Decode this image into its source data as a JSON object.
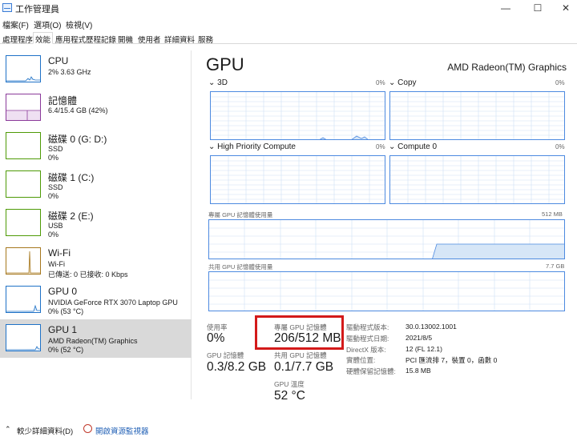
{
  "window": {
    "title": "工作管理員",
    "minimize": "—",
    "maximize": "☐",
    "close": "✕"
  },
  "menu": [
    "檔案(F)",
    "選項(O)",
    "檢視(V)"
  ],
  "tabs": [
    {
      "label": "處理程序"
    },
    {
      "label": "效能",
      "active": true
    },
    {
      "label": "應用程式歷程記錄"
    },
    {
      "label": "開機"
    },
    {
      "label": "使用者"
    },
    {
      "label": "詳細資料"
    },
    {
      "label": "服務"
    }
  ],
  "sidebar": {
    "items": [
      {
        "name": "CPU",
        "line2": "2% 3.63 GHz",
        "line3": "",
        "color": "#1f72c7"
      },
      {
        "name": "記憶體",
        "line2": "6.4/15.4 GB (42%)",
        "line3": "",
        "color": "#8b3a9a"
      },
      {
        "name": "磁碟 0 (G: D:)",
        "line2": "SSD",
        "line3": "0%",
        "color": "#4e9a06"
      },
      {
        "name": "磁碟 1 (C:)",
        "line2": "SSD",
        "line3": "0%",
        "color": "#4e9a06"
      },
      {
        "name": "磁碟 2 (E:)",
        "line2": "USB",
        "line3": "0%",
        "color": "#4e9a06"
      },
      {
        "name": "Wi-Fi",
        "line2": "Wi-Fi",
        "line3": "已傳送: 0 已接收: 0 Kbps",
        "color": "#a6771d"
      },
      {
        "name": "GPU 0",
        "line2": "NVIDIA GeForce RTX 3070 Laptop GPU",
        "line3": "0% (53 °C)",
        "color": "#1f72c7"
      },
      {
        "name": "GPU 1",
        "line2": "AMD Radeon(TM) Graphics",
        "line3": "0% (52 °C)",
        "color": "#1f72c7",
        "selected": true
      }
    ]
  },
  "main": {
    "title": "GPU",
    "device_name": "AMD Radeon(TM) Graphics",
    "engines": [
      {
        "label": "3D",
        "pct": "0%"
      },
      {
        "label": "Copy",
        "pct": "0%"
      },
      {
        "label": "High Priority Compute",
        "pct": "0%"
      },
      {
        "label": "Compute 0",
        "pct": "0%"
      }
    ],
    "dedicated_mem": {
      "label": "專屬 GPU 記憶體使用量",
      "max": "512 MB"
    },
    "shared_mem": {
      "label": "共用 GPU 記憶體使用量",
      "max": "7.7 GB"
    },
    "stats": {
      "utilization_label": "使用率",
      "utilization_value": "0%",
      "dedicated_label": "專屬 GPU 記憶體",
      "dedicated_value": "206/512 MB",
      "gpu_mem_label": "GPU 記憶體",
      "gpu_mem_value": "0.3/8.2 GB",
      "shared_label": "共用 GPU 記憶體",
      "shared_value": "0.1/7.7 GB",
      "temp_label": "GPU 溫度",
      "temp_value": "52 °C"
    },
    "info": [
      {
        "key": "驅動程式版本:",
        "value": "30.0.13002.1001"
      },
      {
        "key": "驅動程式日期:",
        "value": "2021/8/5"
      },
      {
        "key": "DirectX 版本:",
        "value": "12 (FL 12.1)"
      },
      {
        "key": "實體位置:",
        "value": "PCI 匯流排 7，裝置 0，函數 0"
      },
      {
        "key": "硬體保留記憶體:",
        "value": "15.8 MB"
      }
    ]
  },
  "footer": {
    "fewer_details": "較少詳細資料(D)",
    "open_monitor": "開啟資源監視器"
  }
}
